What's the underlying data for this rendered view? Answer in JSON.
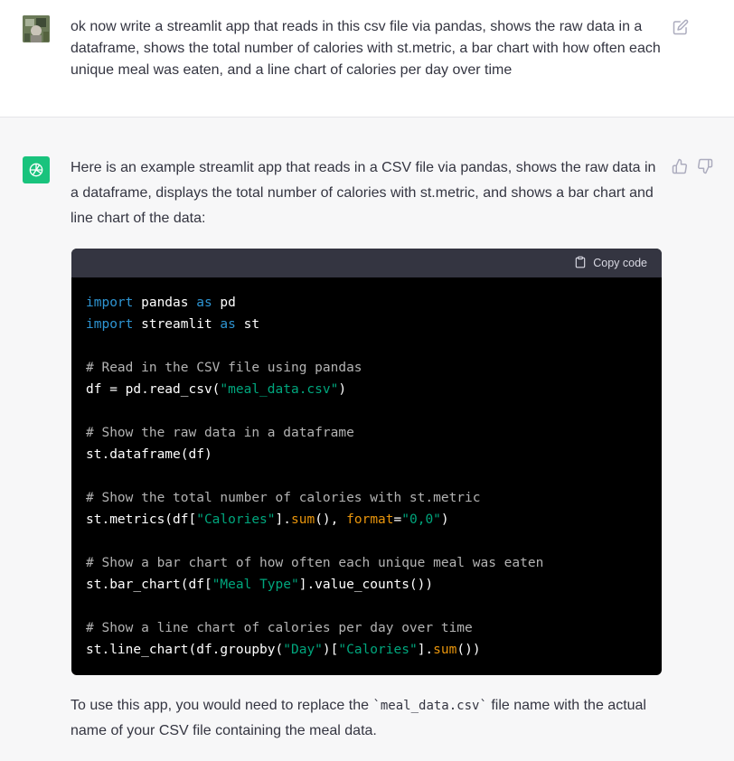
{
  "user_message": {
    "text": "ok now write a streamlit app that reads in this csv file via pandas, shows the raw data in a dataframe, shows the total number of calories with st.metric, a bar chart with how often each unique meal was eaten, and a line chart of calories per day over time"
  },
  "assistant_message": {
    "intro": "Here is an example streamlit app that reads in a CSV file via pandas, shows the raw data in a dataframe, displays the total number of calories with st.metric, and shows a bar chart and line chart of the data:",
    "copy_label": "Copy code",
    "code": {
      "l1_kw1": "import",
      "l1_mod": " pandas ",
      "l1_kw2": "as",
      "l1_alias": " pd",
      "l2_kw1": "import",
      "l2_mod": " streamlit ",
      "l2_kw2": "as",
      "l2_alias": " st",
      "c1": "# Read in the CSV file using pandas",
      "l4_a": "df = pd.read_csv(",
      "l4_s": "\"meal_data.csv\"",
      "l4_b": ")",
      "c2": "# Show the raw data in a dataframe",
      "l6": "st.dataframe(df)",
      "c3": "# Show the total number of calories with st.metric",
      "l8_a": "st.metrics(df[",
      "l8_s": "\"Calories\"",
      "l8_b": "].",
      "l8_fn": "sum",
      "l8_c": "(), ",
      "l8_kw": "format",
      "l8_d": "=",
      "l8_s2": "\"0,0\"",
      "l8_e": ")",
      "c4": "# Show a bar chart of how often each unique meal was eaten",
      "l10_a": "st.bar_chart(df[",
      "l10_s": "\"Meal Type\"",
      "l10_b": "].value_counts())",
      "c5": "# Show a line chart of calories per day over time",
      "l12_a": "st.line_chart(df.groupby(",
      "l12_s": "\"Day\"",
      "l12_b": ")[",
      "l12_s2": "\"Calories\"",
      "l12_c": "].",
      "l12_fn": "sum",
      "l12_d": "())"
    },
    "footer_a": "To use this app, you would need to replace the ",
    "footer_code": "`meal_data.csv`",
    "footer_b": " file name with the actual name of your CSV file containing the meal data."
  },
  "icons": {
    "edit": "edit-icon",
    "thumb_up": "thumbs-up-icon",
    "thumb_down": "thumbs-down-icon",
    "clipboard": "clipboard-icon"
  },
  "colors": {
    "bot_avatar": "#19c37d",
    "code_bg": "#000000",
    "code_header": "#343541",
    "assistant_bg": "#f7f7f8"
  }
}
